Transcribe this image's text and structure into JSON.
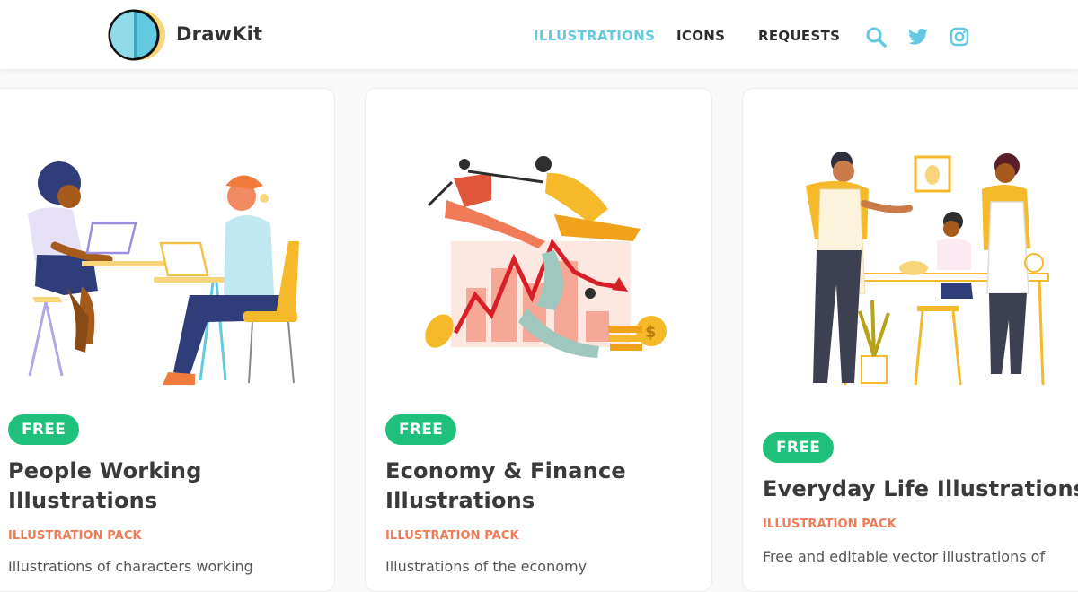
{
  "brand": {
    "name": "DrawKit",
    "logo": "drawkit-logo"
  },
  "nav": {
    "items": [
      {
        "label": "ILLUSTRATIONS",
        "active": true
      },
      {
        "label": "ICONS",
        "active": false
      },
      {
        "label": "REQUESTS",
        "active": false
      }
    ],
    "icons": [
      "search-icon",
      "twitter-icon",
      "instagram-icon"
    ]
  },
  "colors": {
    "accent": "#62c9e0",
    "badge": "#1fc07b",
    "kicker": "#f07b56",
    "title": "#3a3a3a"
  },
  "cards": [
    {
      "badge": "FREE",
      "title_line1": "People Working",
      "title_line2": "Illustrations",
      "kicker": "ILLUSTRATION PACK",
      "description": "Illustrations of characters working"
    },
    {
      "badge": "FREE",
      "title_line1": "Economy & Finance",
      "title_line2": "Illustrations",
      "kicker": "ILLUSTRATION PACK",
      "description": "Illustrations of the economy"
    },
    {
      "badge": "FREE",
      "title_line1": "Everyday Life Illustrations",
      "kicker": "ILLUSTRATION PACK",
      "description": "Free and editable vector illustrations of"
    }
  ]
}
